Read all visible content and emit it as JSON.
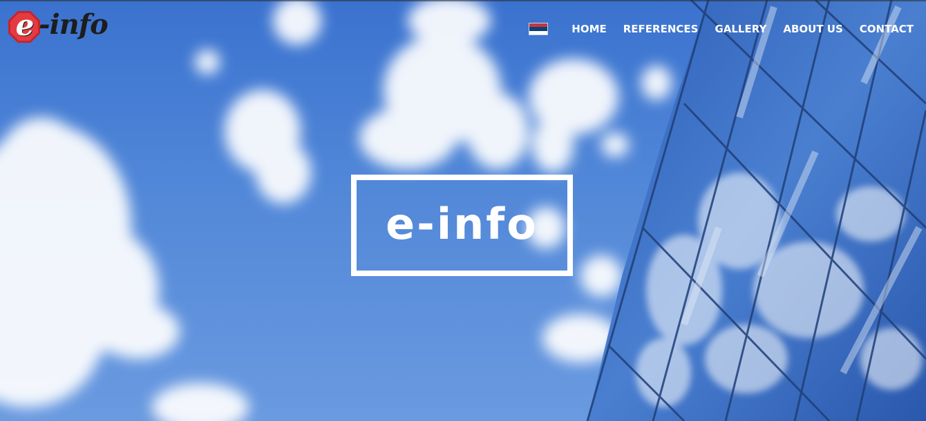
{
  "brand": {
    "logo_letter": "e",
    "logo_text": "-info",
    "logo_alt": "e-info",
    "badge_color": "#c8232b"
  },
  "header": {
    "language_flag": {
      "icon": "serbia-flag-icon",
      "stripes": [
        "#c6363c",
        "#0c4076",
        "#ffffff"
      ]
    },
    "nav": [
      {
        "label": "HOME"
      },
      {
        "label": "REFERENCES"
      },
      {
        "label": "GALLERY"
      },
      {
        "label": "ABOUT US"
      },
      {
        "label": "CONTACT"
      }
    ]
  },
  "hero": {
    "title": "e-info",
    "background": "sky-with-clouds-and-glass-building",
    "sky_color": "#4f86d6"
  }
}
